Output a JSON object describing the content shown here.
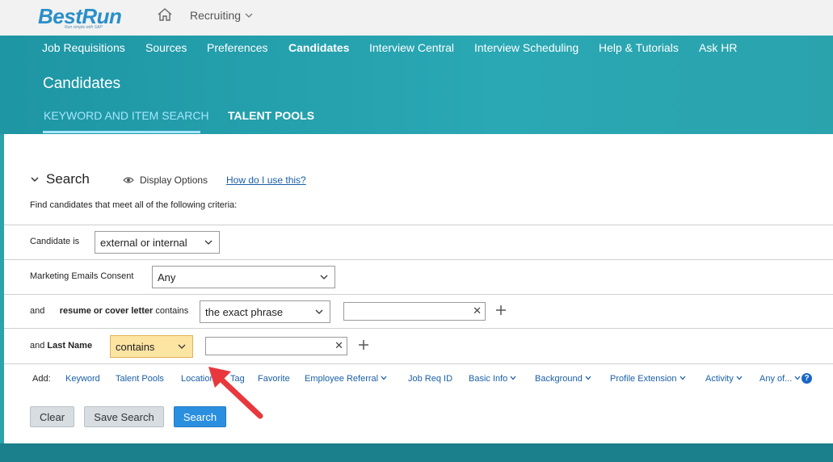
{
  "topbar": {
    "logo": "BestRun",
    "logo_tagline": "Run simple with SAP",
    "module": "Recruiting"
  },
  "nav": {
    "items": [
      {
        "label": "Job Requisitions"
      },
      {
        "label": "Sources"
      },
      {
        "label": "Preferences"
      },
      {
        "label": "Candidates",
        "active": true
      },
      {
        "label": "Interview Central"
      },
      {
        "label": "Interview Scheduling"
      },
      {
        "label": "Help & Tutorials"
      },
      {
        "label": "Ask HR"
      }
    ]
  },
  "page": {
    "title": "Candidates",
    "tabs": [
      {
        "label": "KEYWORD AND ITEM SEARCH",
        "active": true
      },
      {
        "label": "TALENT POOLS"
      }
    ]
  },
  "search": {
    "title": "Search",
    "display_options": "Display Options",
    "help_link": "How do I use this?",
    "instructions": "Find candidates that meet all of the following criteria:",
    "rows": {
      "candidate_is": {
        "label": "Candidate is",
        "value": "external or internal"
      },
      "marketing": {
        "label": "Marketing Emails Consent",
        "value": "Any"
      },
      "resume": {
        "prefix": "and",
        "field": "resume or cover letter",
        "suffix": "contains",
        "value": "the exact phrase",
        "text": ""
      },
      "last_name": {
        "prefix": "and",
        "field": "Last Name",
        "value": "contains",
        "text": ""
      }
    },
    "add": {
      "label": "Add:",
      "items": [
        {
          "label": "Keyword",
          "dropdown": false
        },
        {
          "label": "Talent Pools",
          "dropdown": false
        },
        {
          "label": "Location",
          "dropdown": false
        },
        {
          "label": "Tag",
          "dropdown": false
        },
        {
          "label": "Favorite",
          "dropdown": false
        },
        {
          "label": "Employee Referral",
          "dropdown": true
        },
        {
          "label": "Job Req ID",
          "dropdown": false
        },
        {
          "label": "Basic Info",
          "dropdown": true
        },
        {
          "label": "Background",
          "dropdown": true
        },
        {
          "label": "Profile Extension",
          "dropdown": true
        },
        {
          "label": "Activity",
          "dropdown": true
        },
        {
          "label": "Any of...",
          "dropdown": true
        }
      ]
    },
    "buttons": {
      "clear": "Clear",
      "save": "Save Search",
      "search": "Search"
    }
  },
  "colors": {
    "header": "#2aa3ad",
    "active_tab": "#a6e6ff",
    "link": "#1a5fa8",
    "highlight": "#fce4a3",
    "primary_button": "#2b8fe0",
    "arrow": "#e8383d"
  }
}
